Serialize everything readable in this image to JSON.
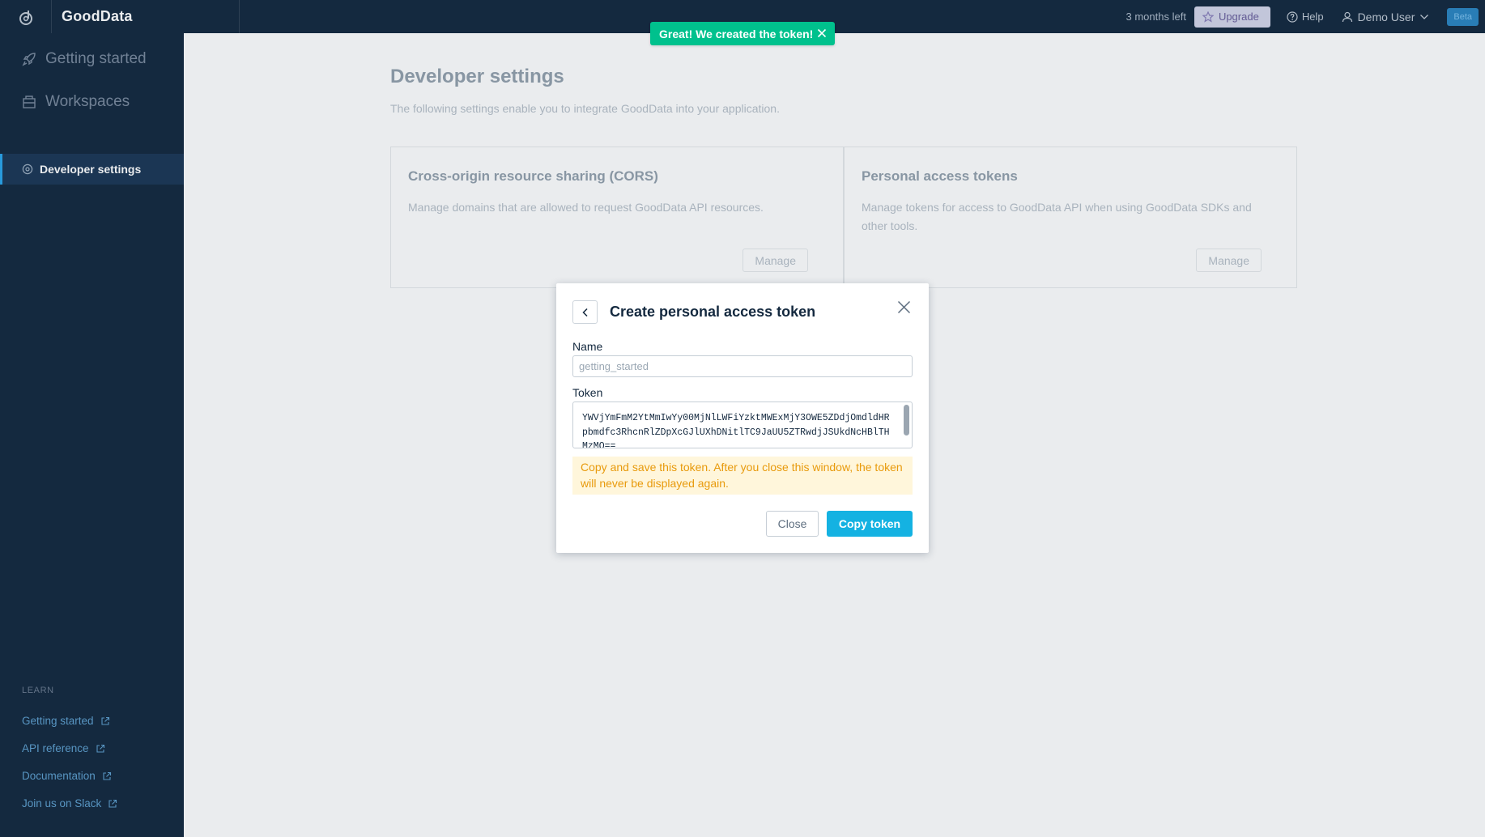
{
  "header": {
    "brand": "GoodData",
    "trial_text": "3 months left",
    "upgrade_label": "Upgrade",
    "help_label": "Help",
    "user_label": "Demo User",
    "beta_label": "Beta"
  },
  "sidebar": {
    "items": [
      {
        "label": "Getting started",
        "icon": "rocket-icon"
      },
      {
        "label": "Workspaces",
        "icon": "workspace-icon"
      },
      {
        "label": "Developer settings",
        "icon": "gear-icon",
        "active": true
      }
    ],
    "learn_title": "LEARN",
    "learn_links": [
      {
        "label": "Getting started"
      },
      {
        "label": "API reference"
      },
      {
        "label": "Documentation"
      },
      {
        "label": "Join us on Slack"
      }
    ]
  },
  "main": {
    "title": "Developer settings",
    "description": "The following settings enable you to integrate GoodData into your application.",
    "cards": [
      {
        "title": "Cross-origin resource sharing (CORS)",
        "description": "Manage domains that are allowed to request GoodData API resources.",
        "button": "Manage"
      },
      {
        "title": "Personal access tokens",
        "description": "Manage tokens for access to GoodData API when using GoodData SDKs and other tools.",
        "button": "Manage"
      }
    ]
  },
  "toast": {
    "message": "Great! We created the token!"
  },
  "dialog": {
    "title": "Create personal access token",
    "name_label": "Name",
    "name_value": "getting_started",
    "token_label": "Token",
    "token_value": "YWVjYmFmM2YtMmIwYy00MjNlLWFiYzktMWExMjY3OWE5ZDdjOmdldHRpbmdfc3RhcnRlZDpXcGJlUXhDNitlTC9JaUU5ZTRwdjJSUkdNcHBlTHMzMQ==",
    "warning": "Copy and save this token. After you close this window, the token will never be displayed again.",
    "close_label": "Close",
    "copy_label": "Copy token"
  },
  "colors": {
    "navy": "#14293f",
    "accent": "#14b2e2",
    "success": "#00c18d",
    "warning_bg": "#fff6db",
    "warning_text": "#e89a0c"
  }
}
